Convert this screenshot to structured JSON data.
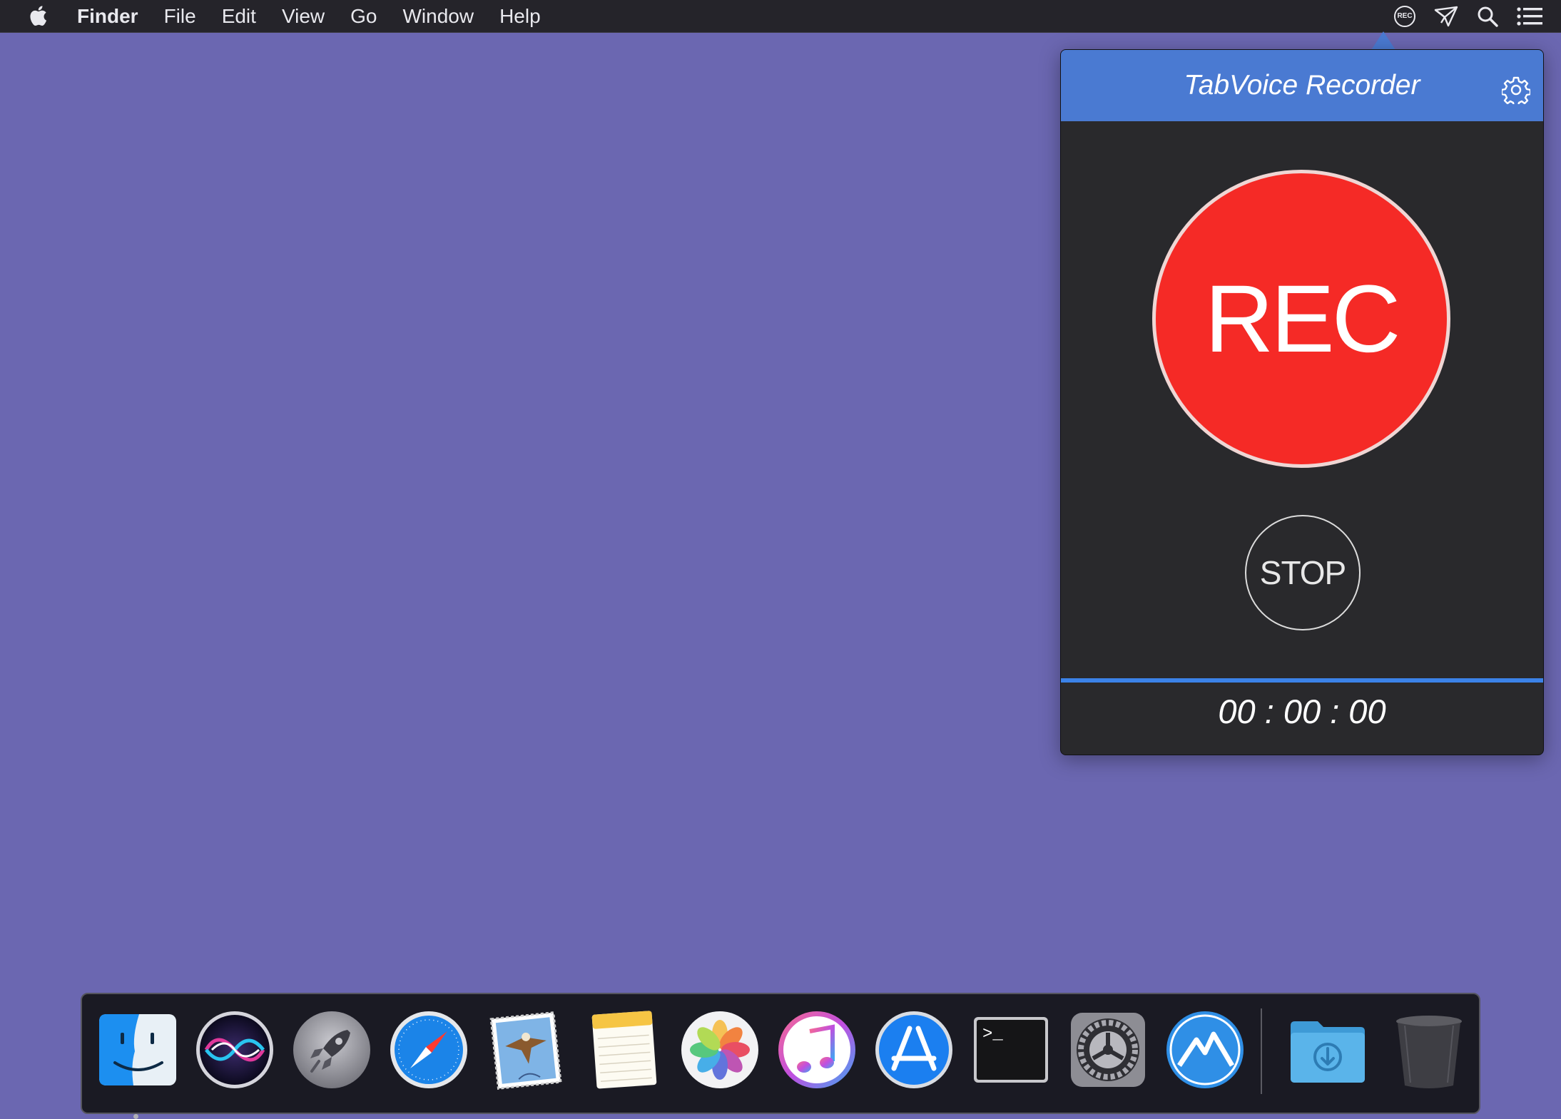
{
  "menubar": {
    "apple_icon": "apple-logo-icon",
    "app_name": "Finder",
    "menus": [
      "File",
      "Edit",
      "View",
      "Go",
      "Window",
      "Help"
    ],
    "tray": {
      "rec_label": "REC",
      "icons": [
        "rec-status-icon",
        "paper-plane-icon",
        "spotlight-search-icon",
        "notification-center-icon"
      ]
    }
  },
  "popover": {
    "title": "TabVoice Recorder",
    "settings_icon": "gear-icon",
    "rec_button_label": "REC",
    "stop_button_label": "STOP",
    "progress": 1.0,
    "timer": "00 : 00 : 00",
    "colors": {
      "header": "#4a7ad2",
      "body": "#29292c",
      "rec_button": "#f52a26",
      "progress": "#3b82e8"
    }
  },
  "desktop": {
    "background": "#6b67b1"
  },
  "dock": {
    "items": [
      {
        "name": "Finder",
        "icon": "finder-icon",
        "running": true
      },
      {
        "name": "Siri",
        "icon": "siri-icon",
        "running": false
      },
      {
        "name": "Launchpad",
        "icon": "launchpad-rocket-icon",
        "running": false
      },
      {
        "name": "Safari",
        "icon": "safari-compass-icon",
        "running": false
      },
      {
        "name": "Mail",
        "icon": "mail-stamp-eagle-icon",
        "running": false
      },
      {
        "name": "Notes",
        "icon": "notes-notepad-icon",
        "running": false
      },
      {
        "name": "Photos",
        "icon": "photos-flower-icon",
        "running": false
      },
      {
        "name": "iTunes",
        "icon": "itunes-music-note-icon",
        "running": false
      },
      {
        "name": "App Store",
        "icon": "app-store-icon",
        "running": false
      },
      {
        "name": "Terminal",
        "icon": "terminal-icon",
        "running": false
      },
      {
        "name": "System Preferences",
        "icon": "system-preferences-gear-icon",
        "running": false
      },
      {
        "name": "Mountain app",
        "icon": "mountain-app-icon",
        "running": false
      },
      {
        "name": "Downloads",
        "icon": "downloads-folder-icon",
        "running": false
      },
      {
        "name": "Trash",
        "icon": "trash-icon",
        "running": false
      }
    ],
    "terminal_prompt": ">_"
  }
}
